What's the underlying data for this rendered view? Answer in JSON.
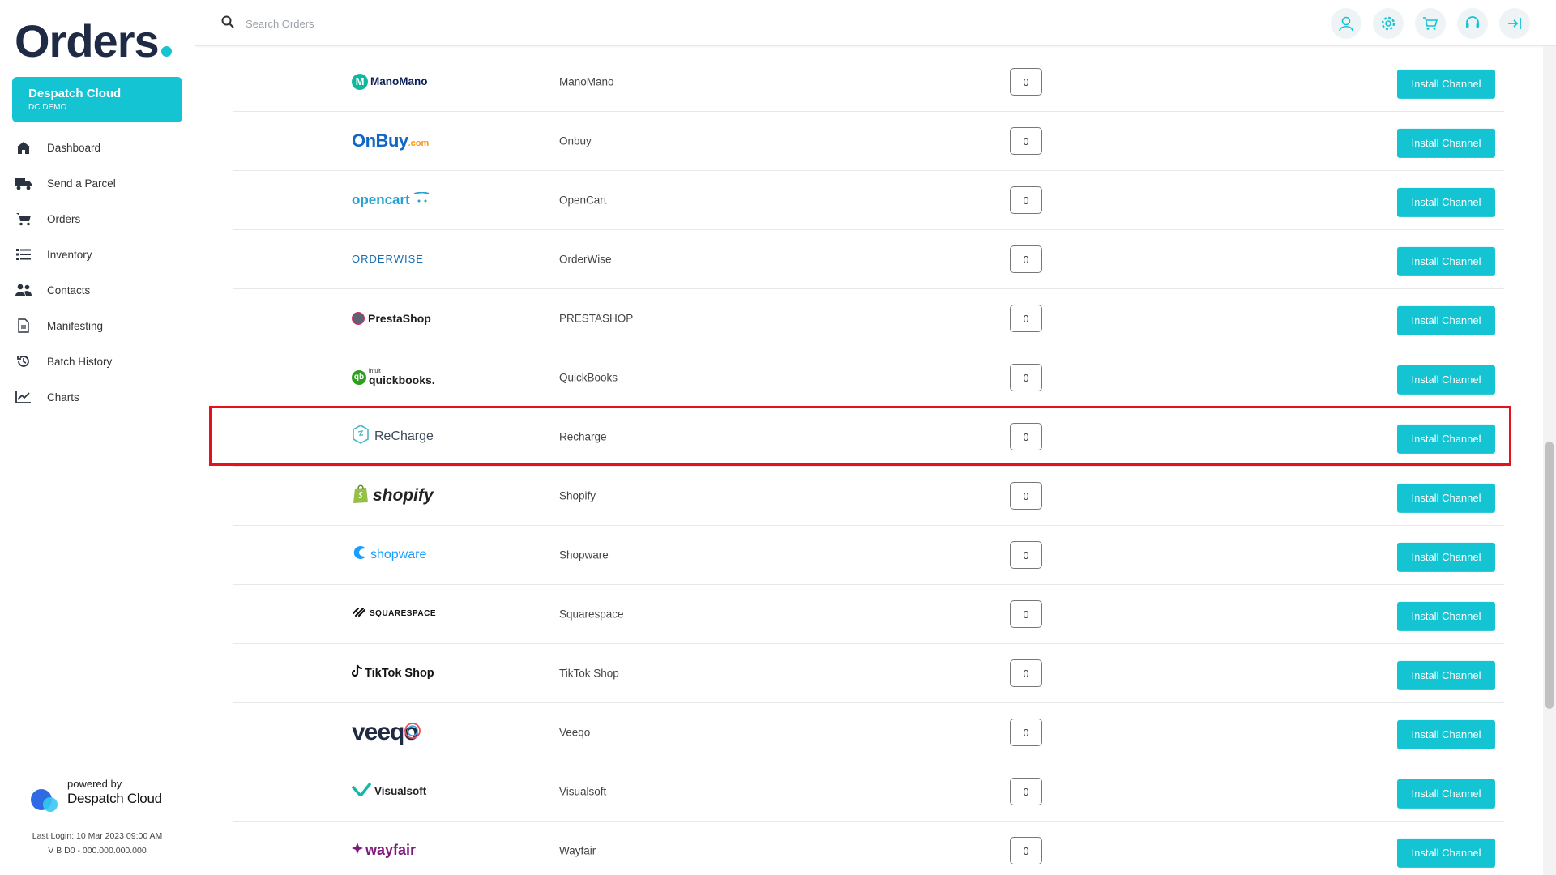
{
  "app": {
    "brand": "Orders",
    "account_name": "Despatch Cloud",
    "account_sub": "DC DEMO",
    "powered_by": "powered by",
    "powered_brand": "Despatch Cloud",
    "last_login": "Last Login: 10 Mar 2023 09:00 AM",
    "version": "V B D0 - 000.000.000.000"
  },
  "nav": [
    {
      "label": "Dashboard",
      "icon": "home-icon"
    },
    {
      "label": "Send a Parcel",
      "icon": "truck-icon"
    },
    {
      "label": "Orders",
      "icon": "cart-icon"
    },
    {
      "label": "Inventory",
      "icon": "list-icon"
    },
    {
      "label": "Contacts",
      "icon": "users-icon"
    },
    {
      "label": "Manifesting",
      "icon": "document-icon"
    },
    {
      "label": "Batch History",
      "icon": "history-icon"
    },
    {
      "label": "Charts",
      "icon": "chart-icon"
    }
  ],
  "search": {
    "placeholder": "Search Orders"
  },
  "top_icons": [
    "user-icon",
    "settings-icon",
    "cart-icon",
    "support-icon",
    "logout-icon"
  ],
  "colors": {
    "accent": "#14c4d3",
    "highlight": "#e8101c",
    "brand_dark": "#1f2a44"
  },
  "channels": [
    {
      "logo": "ManoMano",
      "name": "ManoMano",
      "count": "0",
      "button": "Install Channel"
    },
    {
      "logo": "OnBuy",
      "logo_suffix": ".com",
      "name": "Onbuy",
      "count": "0",
      "button": "Install Channel"
    },
    {
      "logo": "opencart",
      "name": "OpenCart",
      "count": "0",
      "button": "Install Channel"
    },
    {
      "logo": "ORDERWISE",
      "name": "OrderWise",
      "count": "0",
      "button": "Install Channel"
    },
    {
      "logo": "PrestaShop",
      "name": "PRESTASHOP",
      "count": "0",
      "button": "Install Channel"
    },
    {
      "logo": "quickbooks.",
      "logo_prefix": "intuit",
      "name": "QuickBooks",
      "count": "0",
      "button": "Install Channel"
    },
    {
      "logo": "ReCharge",
      "name": "Recharge",
      "count": "0",
      "button": "Install Channel"
    },
    {
      "logo": "shopify",
      "name": "Shopify",
      "count": "0",
      "button": "Install Channel"
    },
    {
      "logo": "shopware",
      "name": "Shopware",
      "count": "0",
      "button": "Install Channel"
    },
    {
      "logo": "SQUARESPACE",
      "name": "Squarespace",
      "count": "0",
      "button": "Install Channel"
    },
    {
      "logo": "TikTok Shop",
      "name": "TikTok Shop",
      "count": "0",
      "button": "Install Channel"
    },
    {
      "logo": "veeqo",
      "name": "Veeqo",
      "count": "0",
      "button": "Install Channel"
    },
    {
      "logo": "Visualsoft",
      "name": "Visualsoft",
      "count": "0",
      "button": "Install Channel"
    },
    {
      "logo": "wayfair",
      "name": "Wayfair",
      "count": "0",
      "button": "Install Channel"
    }
  ]
}
